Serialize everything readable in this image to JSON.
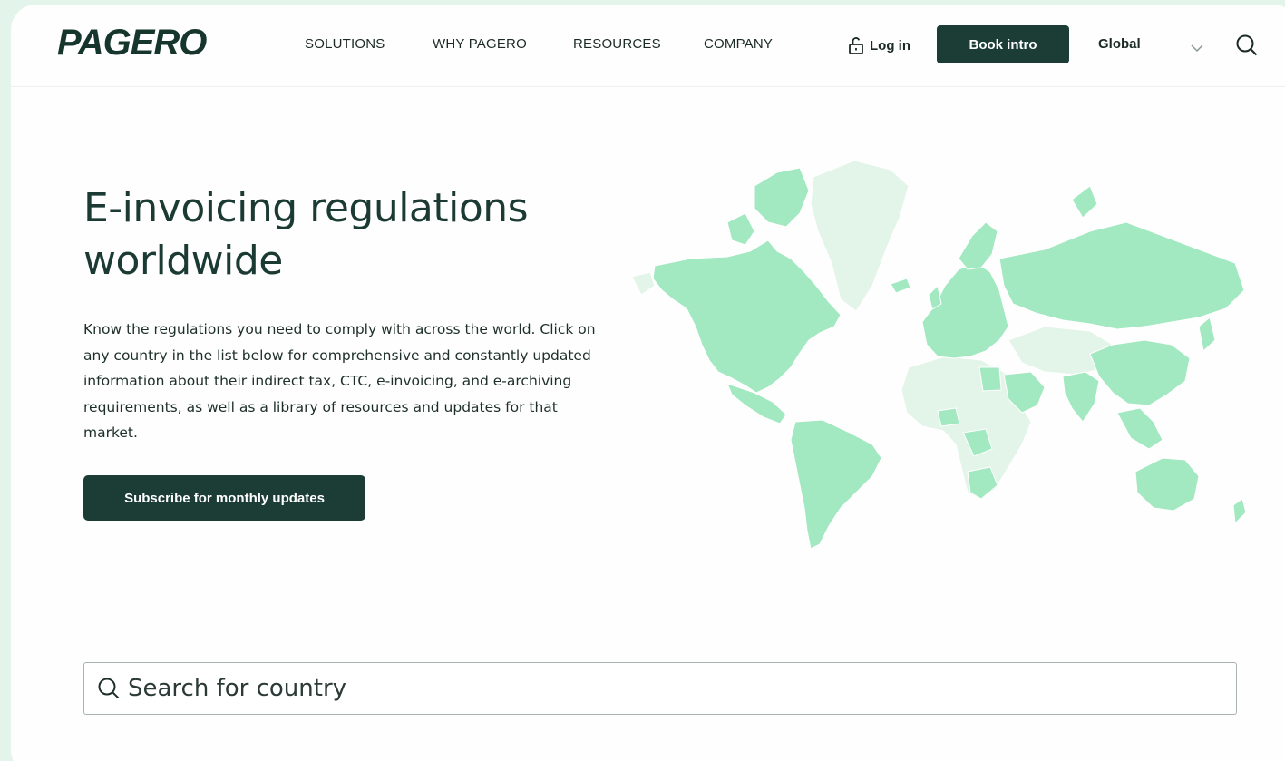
{
  "header": {
    "logo": "PAGERO",
    "nav": [
      "SOLUTIONS",
      "WHY PAGERO",
      "RESOURCES",
      "COMPANY"
    ],
    "login_label": "Log in",
    "book_label": "Book intro",
    "region_label": "Global"
  },
  "hero": {
    "title": "E-invoicing regulations worldwide",
    "description": "Know the regulations you need to comply with across the world. Click on any country in the list below for comprehensive and constantly updated information about their indirect tax, CTC, e-invoicing, and e-archiving requirements, as well as a library of resources and updates for that market.",
    "subscribe_label": "Subscribe for monthly updates"
  },
  "search": {
    "placeholder": "Search for country"
  },
  "colors": {
    "brand_dark": "#1b3d35",
    "map_active": "#a2e8c0",
    "map_inactive": "#e3f4e9",
    "frame_bg": "#e3f5ea"
  },
  "icons": {
    "login": "unlock-icon",
    "region": "chevron-down-icon",
    "search": "search-icon"
  }
}
